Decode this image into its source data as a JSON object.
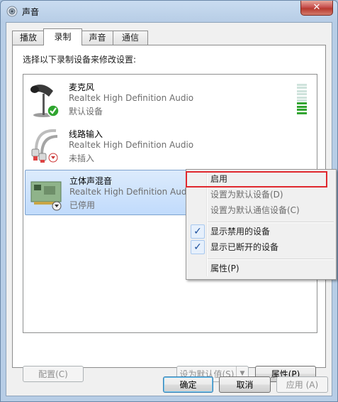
{
  "window": {
    "title": "声音",
    "close_glyph": "✕"
  },
  "tabs": [
    {
      "label": "播放",
      "active": false
    },
    {
      "label": "录制",
      "active": true
    },
    {
      "label": "声音",
      "active": false
    },
    {
      "label": "通信",
      "active": false
    }
  ],
  "instruction": "选择以下录制设备来修改设置:",
  "devices": [
    {
      "name": "麦克风",
      "driver": "Realtek High Definition Audio",
      "status": "默认设备",
      "icon": "microphone-icon",
      "badge": "green-check-badge-icon",
      "selected": false
    },
    {
      "name": "线路输入",
      "driver": "Realtek High Definition Audio",
      "status": "未插入",
      "icon": "line-in-cable-icon",
      "badge": "red-down-arrow-badge-icon",
      "selected": false
    },
    {
      "name": "立体声混音",
      "driver": "Realtek High Definition Audio",
      "status": "已停用",
      "icon": "sound-card-icon",
      "badge": "gray-down-arrow-badge-icon",
      "selected": true
    }
  ],
  "level_meter": {
    "active_bars": 4,
    "total_bars": 10,
    "active_color": "#33a532"
  },
  "buttons": {
    "configure": "配置(C)",
    "set_default": "设为默认值(S)",
    "properties": "属性(P)",
    "ok": "确定",
    "cancel": "取消",
    "apply": "应用 (A)"
  },
  "context_menu": {
    "items": [
      {
        "label": "启用",
        "enabled": true,
        "checked": false
      },
      {
        "label": "设置为默认设备(D)",
        "enabled": false,
        "checked": false
      },
      {
        "label": "设置为默认通信设备(C)",
        "enabled": false,
        "checked": false
      },
      {
        "label": "显示禁用的设备",
        "enabled": true,
        "checked": true
      },
      {
        "label": "显示已断开的设备",
        "enabled": true,
        "checked": true
      },
      {
        "label": "属性(P)",
        "enabled": true,
        "checked": false
      }
    ]
  },
  "colors": {
    "highlight_border": "#e0282e",
    "selection": "#c1dbfc",
    "accent": "#3c7fb1"
  }
}
